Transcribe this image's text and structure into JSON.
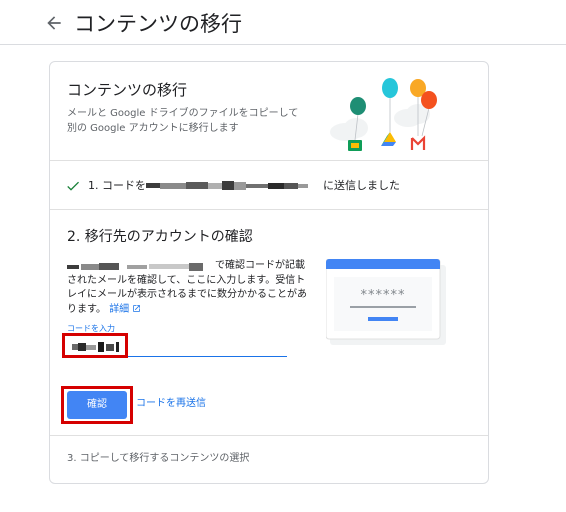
{
  "header": {
    "title": "コンテンツの移行",
    "back_icon": "arrow-back-icon"
  },
  "intro": {
    "title": "コンテンツの移行",
    "description": "メールと Google ドライブのファイルをコピーして別の Google アカウントに移行します"
  },
  "step1": {
    "text": "1. コードを",
    "suffix": "に送信しました",
    "status": "done",
    "check_color": "#188038"
  },
  "step2": {
    "title": "2. 移行先のアカウントの確認",
    "body": "で確認コードが記載されたメールを確認して、ここに入力します。受信トレイにメールが表示されるまでに数分かかることがあります。",
    "details_link": "詳細",
    "code_label": "コードを入力",
    "code_value": "",
    "confirm_button": "確認",
    "resend_link": "コードを再送信",
    "illustration_mask": "******"
  },
  "step3": {
    "text": "3. コピーして移行するコンテンツの選択"
  },
  "colors": {
    "accent": "#1a73e8",
    "button": "#4285f4",
    "highlight_box": "#d50000"
  }
}
